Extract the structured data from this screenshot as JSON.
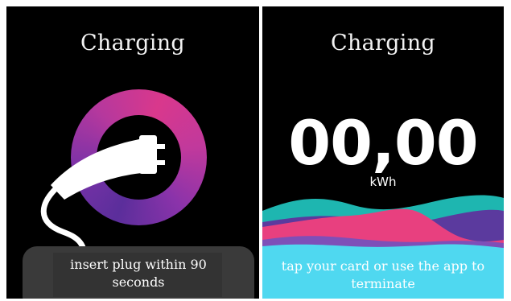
{
  "left_screen": {
    "title": "Charging",
    "message": "insert plug within 90 seconds",
    "icons": [
      "charging-ring",
      "ev-plug-icon"
    ]
  },
  "right_screen": {
    "title": "Charging",
    "energy_value": "00,00",
    "energy_unit": "kWh",
    "message": "tap your card or use the app to terminate"
  },
  "colors": {
    "background": "#000000",
    "ring_magenta": "#d9388c",
    "ring_purple": "#5b2e9b",
    "wave_cyan": "#4fd8f0",
    "wave_pink": "#e8407f",
    "wave_teal": "#1eb6b0",
    "wave_violet": "#5b3a9e",
    "text": "#ffffff"
  }
}
